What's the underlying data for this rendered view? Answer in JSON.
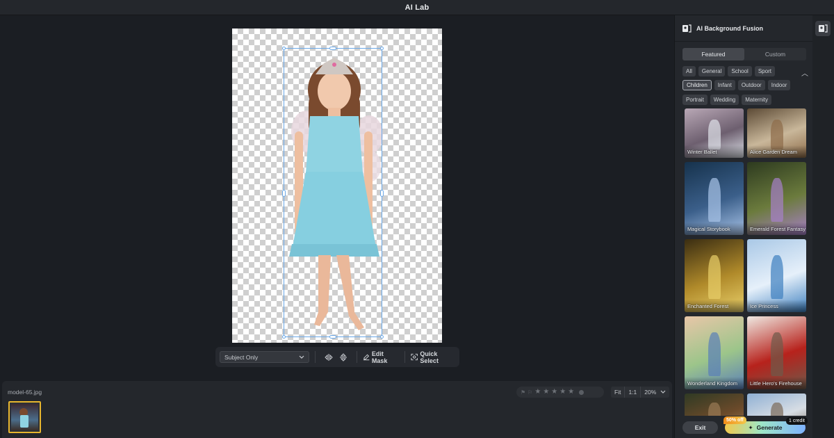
{
  "window": {
    "title": "AI Lab"
  },
  "canvas_toolbar": {
    "mask_mode": "Subject Only",
    "edit_mask_label": "Edit Mask",
    "quick_select_label": "Quick Select"
  },
  "filmstrip": {
    "filename": "model-65.jpg",
    "rating": {
      "stars": 0,
      "max": 5
    },
    "zoom": {
      "fit": "Fit",
      "one_to_one": "1:1",
      "level": "20%"
    }
  },
  "panel": {
    "title": "AI Background Fusion",
    "tabs": [
      {
        "label": "Featured",
        "active": true
      },
      {
        "label": "Custom",
        "active": false
      }
    ],
    "filters_row1": [
      {
        "label": "All",
        "active": false
      },
      {
        "label": "General",
        "active": false
      },
      {
        "label": "School",
        "active": false
      },
      {
        "label": "Sport",
        "active": false
      }
    ],
    "filters_row2": [
      {
        "label": "Children",
        "active": true
      },
      {
        "label": "Infant",
        "active": false
      },
      {
        "label": "Outdoor",
        "active": false
      },
      {
        "label": "Indoor",
        "active": false
      }
    ],
    "filters_row3": [
      {
        "label": "Portrait",
        "active": false
      },
      {
        "label": "Wedding",
        "active": false
      },
      {
        "label": "Maternity",
        "active": false
      }
    ],
    "presets": [
      {
        "name": "Winter Ballet",
        "colors": [
          "#b9a8b6",
          "#6d5f6f",
          "#dfe3ea"
        ]
      },
      {
        "name": "Alice Garden Dream",
        "colors": [
          "#5c4a35",
          "#c9b79a",
          "#8d6b48"
        ]
      },
      {
        "name": "Magical Storybook",
        "colors": [
          "#16324c",
          "#3b5f8a",
          "#a9c4e8"
        ]
      },
      {
        "name": "Emerald Forest Fantasy",
        "colors": [
          "#2d3a1f",
          "#6b7b3d",
          "#a780c9"
        ]
      },
      {
        "name": "Enchanted Forest",
        "colors": [
          "#3a2d12",
          "#b08a2a",
          "#e8cf6a"
        ]
      },
      {
        "name": "Ice Princess",
        "colors": [
          "#a9c8e6",
          "#e6f0fa",
          "#3d7fbf"
        ]
      },
      {
        "name": "Wonderland Kingdom",
        "colors": [
          "#e8c6a8",
          "#9cc58a",
          "#5a7fb8"
        ]
      },
      {
        "name": "Little Hero's Firehouse",
        "colors": [
          "#efe9e2",
          "#b7221c",
          "#6e5a4a"
        ]
      },
      {
        "name": "",
        "colors": [
          "#2f3a24",
          "#6b4a2a",
          "#9a7a55"
        ]
      },
      {
        "name": "",
        "colors": [
          "#8fb0d4",
          "#d7dde4",
          "#7a6a58"
        ]
      }
    ],
    "exit_label": "Exit",
    "generate_label": "Generate",
    "discount_label": "50% off",
    "credit_label": "1 credit"
  }
}
